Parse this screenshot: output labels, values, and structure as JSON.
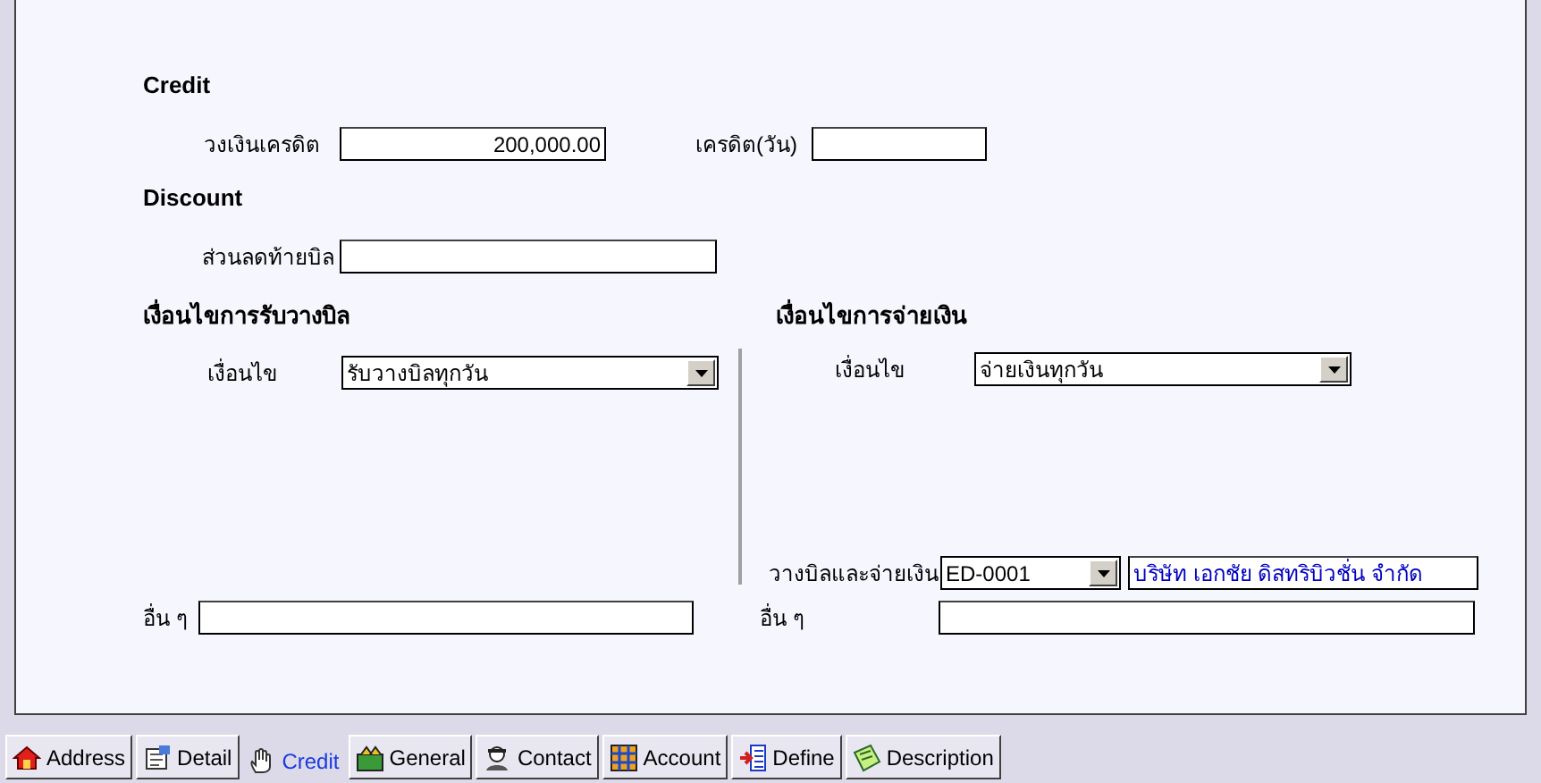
{
  "credit": {
    "title": "Credit",
    "limit": {
      "label": "วงเงินเครดิต",
      "value": "200,000.00"
    },
    "days": {
      "label": "เครดิต(วัน)"
    }
  },
  "discount": {
    "title": "Discount",
    "end_of_bill": {
      "label": "ส่วนลดท้ายบิล"
    }
  },
  "billing": {
    "title": "เงื่อนไขการรับวางบิล",
    "condition": {
      "label": "เงื่อนไข",
      "value": "รับวางบิลทุกวัน"
    },
    "other": {
      "label": "อื่น ๆ"
    }
  },
  "payment": {
    "title": "เงื่อนไขการจ่ายเงิน",
    "condition": {
      "label": "เงื่อนไข",
      "value": "จ่ายเงินทุกวัน"
    },
    "billing_and_payment": {
      "label": "วางบิลและจ่ายเงิน",
      "code": "ED-0001",
      "name": "บริษัท เอกชัย ดิสทริบิวชั่น จำกัด"
    },
    "other": {
      "label": "อื่น ๆ"
    }
  },
  "tabs": [
    {
      "label": "Address",
      "selected": false
    },
    {
      "label": "Detail",
      "selected": false
    },
    {
      "label": "Credit",
      "selected": true
    },
    {
      "label": "General",
      "selected": false
    },
    {
      "label": "Contact",
      "selected": false
    },
    {
      "label": "Account",
      "selected": false
    },
    {
      "label": "Define",
      "selected": false
    },
    {
      "label": "Description",
      "selected": false
    }
  ]
}
